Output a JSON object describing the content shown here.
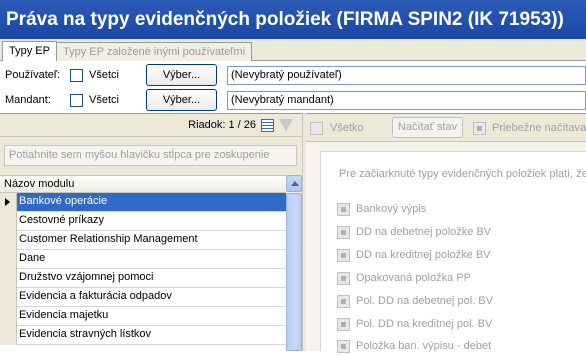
{
  "title": "Práva na typy evidenčných položiek (FIRMA SPIN2 (IK 71953))",
  "tabs": [
    {
      "label": "Typy EP",
      "active": true
    },
    {
      "label": "Typy EP založené inými používateľmi",
      "active": false
    }
  ],
  "filters": {
    "user": {
      "label": "Používateľ:",
      "all_label": "Všetci",
      "all_checked": false,
      "button": "Výber...",
      "value": "(Nevybratý používateľ)"
    },
    "mandant": {
      "label": "Mandant:",
      "all_label": "Všetci",
      "all_checked": false,
      "button": "Výber...",
      "value": "(Nevybratý mandant)"
    }
  },
  "left": {
    "row_counter": "Riadok: 1 / 26",
    "group_hint": "Potiahnite sem myšou hlavičku stĺpca pre zoskupenie",
    "column_header": "Názov modulu",
    "rows": [
      "Bankové operácie",
      "Cestovné príkazy",
      "Customer Relationship Management",
      "Dane",
      "Družstvo vzájomnej pomoci",
      "Evidencia a fakturácia odpadov",
      "Evidencia majetku",
      "Evidencia stravných lístkov"
    ],
    "selected_index": 0
  },
  "right": {
    "select_all_label": "Všetko",
    "load_button": "Načítať stav",
    "continuous_label": "Priebežne načítavať",
    "notice": "Pre začiarknuté typy evidenčných položiek platí, že",
    "items": [
      "Bankový výpis",
      "DD na debetnej položke BV",
      "DD na kreditnej položke BV",
      "Opakovaná položka PP",
      "Pol. DD na debetnej pol. BV",
      "Pol. DD na kreditnej pol. BV",
      "Položka ban. výpisu - debet"
    ]
  },
  "colors": {
    "title_bg": "#1a47a3",
    "selection": "#3169c6",
    "chrome": "#ece9d8"
  }
}
